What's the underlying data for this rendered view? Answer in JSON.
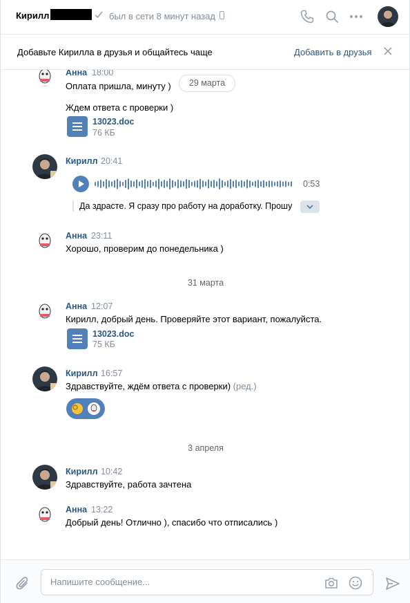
{
  "header": {
    "name": "Кирилл",
    "status": "был в сети 8 минут назад",
    "icons": [
      "check-icon",
      "mobile-icon",
      "phone-icon",
      "search-icon",
      "more-icon"
    ]
  },
  "friend_bar": {
    "text": "Добавьте Кирилла в друзья и общайтесь чаще",
    "add_label": "Добавить в друзья"
  },
  "messages": {
    "m1": {
      "author": "Анна",
      "time": "18:00",
      "text": "Оплата пришла, минуту )"
    },
    "m1b": {
      "text": "Ждем ответа с проверки )"
    },
    "m1c": {
      "doc_name": "13023.doc",
      "doc_size": "76 КБ"
    },
    "m2": {
      "author": "Кирилл",
      "time": "20:41",
      "duration": "0:53",
      "transcript": "Да здрасте. Я сразу про работу на доработку. Прошу прощения"
    },
    "m3": {
      "author": "Анна",
      "time": "23:11",
      "text": "Хорошо, проверим до понедельника )"
    },
    "m4": {
      "author": "Анна",
      "time": "12:07",
      "text": "Кирилл, добрый день. Проверяйте этот вариант, пожалуйста.",
      "doc_name": "13023.doc",
      "doc_size": "75 КБ"
    },
    "m5": {
      "author": "Кирилл",
      "time": "16:57",
      "text": "Здравствуйте, ждём ответа с проверки)",
      "edited": "(ред.)"
    },
    "m6": {
      "author": "Кирилл",
      "time": "10:42",
      "text": "Здравствуйте, работа зачтена"
    },
    "m7": {
      "author": "Анна",
      "time": "13:22",
      "text": "Добрый день! Отлично ), спасибо что отписались )"
    }
  },
  "dates": {
    "d1": "29 марта",
    "d2": "31 марта",
    "d3": "3 апреля"
  },
  "composer": {
    "placeholder": "Напишите сообщение..."
  },
  "colors": {
    "accent": "#5181b8",
    "link": "#2a5885",
    "muted": "#818c99"
  }
}
